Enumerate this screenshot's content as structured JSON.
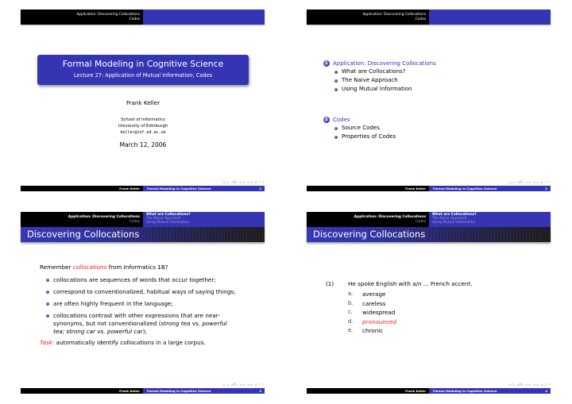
{
  "header": {
    "sections": [
      "Application: Discovering Collocations",
      "Codes"
    ],
    "subsections": [
      "What are Collocations?",
      "The Naive Approach",
      "Using Mutual Information"
    ]
  },
  "footer": {
    "author": "Frank Keller",
    "title": "Formal Modeling in Cognitive Science",
    "nav_symbols": "◂□▸ ◂🗗▸ ◂≡▸ ◂≡▸ ≣ ↶↷"
  },
  "slide1": {
    "title": "Formal Modeling in Cognitive Science",
    "subtitle": "Lecture 27: Application of Mutual Information; Codes",
    "author": "Frank Keller",
    "institute": [
      "School of Informatics",
      "University of Edinburgh"
    ],
    "email": "keller@inf.ed.ac.uk",
    "date": "March 12, 2006",
    "page": "1"
  },
  "slide2": {
    "toc": [
      {
        "num": "1",
        "title": "Application: Discovering Collocations",
        "items": [
          "What are Collocations?",
          "The Naive Approach",
          "Using Mutual Information"
        ]
      },
      {
        "num": "2",
        "title": "Codes",
        "items": [
          "Source Codes",
          "Properties of Codes"
        ]
      }
    ],
    "page": "2"
  },
  "slide3": {
    "frame_title": "Discovering Collocations",
    "intro_pre": "Remember ",
    "intro_em": "collocations",
    "intro_post": " from Informatics 1B?",
    "bullets": [
      "collocations are sequences of words that occur together;",
      "correspond to conventionalized, habitual ways of saying things;",
      "are often highly frequent in the language;"
    ],
    "bullet4": {
      "a": "collocations contrast with other expressions that are near-synonyms, but not conventionalized (",
      "b": "strong tea",
      "c": " vs. ",
      "d": "powerful tea; strong car",
      "e": " vs. ",
      "f": "powerful car",
      "g": ");"
    },
    "task_label": "Task:",
    "task_text": " automatically identify collocations in a large corpus.",
    "page": "3"
  },
  "slide4": {
    "frame_title": "Discovering Collocations",
    "example_num": "(1)",
    "example_text": "He spoke English with a/n ... French accent.",
    "options": [
      {
        "key": "a.",
        "text": "average",
        "highlight": false
      },
      {
        "key": "b.",
        "text": "careless",
        "highlight": false
      },
      {
        "key": "c.",
        "text": "widespread",
        "highlight": false
      },
      {
        "key": "d.",
        "text": "pronounced",
        "highlight": true
      },
      {
        "key": "e.",
        "text": "chronic",
        "highlight": false
      }
    ],
    "page": "4"
  },
  "colors": {
    "beamer_blue": "#3535b4",
    "alert_red": "#ee1c1c",
    "bar_black": "#000000"
  }
}
